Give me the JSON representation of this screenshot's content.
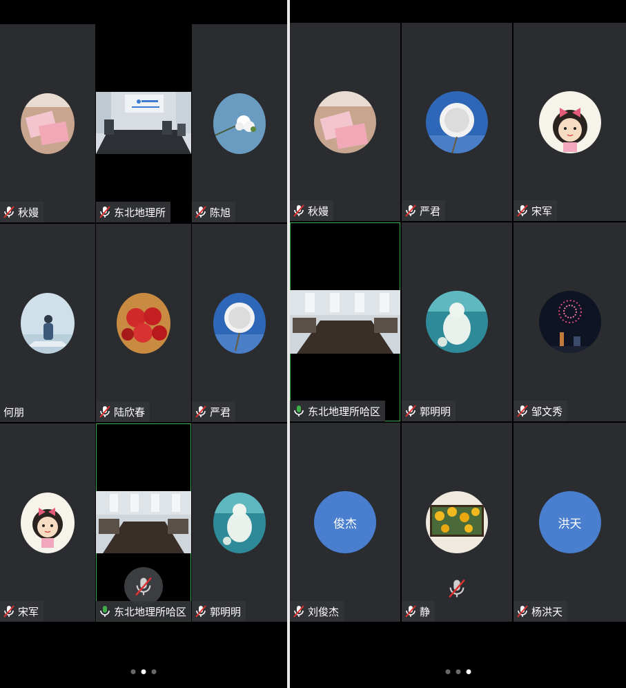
{
  "left_panel": {
    "tiles": [
      {
        "name": "秋嫚",
        "avatar": "red-envelope-photo",
        "mic": "muted"
      },
      {
        "name": "东北地理所",
        "video": "meeting-room-video",
        "mic": "muted"
      },
      {
        "name": "陈旭",
        "avatar": "white-flower-photo",
        "mic": "muted"
      },
      {
        "name": "何朋",
        "avatar": "person-on-boat-photo",
        "mic": "none"
      },
      {
        "name": "陆欣春",
        "avatar": "apples-photo",
        "mic": "muted"
      },
      {
        "name": "严君",
        "avatar": "dandelion-photo",
        "mic": "muted"
      },
      {
        "name": "宋军",
        "avatar": "cartoon-girl-photo",
        "mic": "muted"
      },
      {
        "name": "东北地理所哈区",
        "video": "meeting-room-video",
        "mic": "active"
      },
      {
        "name": "郭明明",
        "avatar": "polar-bear-photo",
        "mic": "muted"
      }
    ],
    "page_dots": 3,
    "active_dot": 1
  },
  "right_panel": {
    "tiles": [
      {
        "name": "秋嫚",
        "avatar": "red-envelope-photo",
        "mic": "muted"
      },
      {
        "name": "严君",
        "avatar": "dandelion-photo",
        "mic": "muted"
      },
      {
        "name": "宋军",
        "avatar": "cartoon-girl-photo",
        "mic": "muted"
      },
      {
        "name": "东北地理所哈区",
        "video": "meeting-room-video",
        "mic": "active"
      },
      {
        "name": "郭明明",
        "avatar": "polar-bear-photo",
        "mic": "muted"
      },
      {
        "name": "邹文秀",
        "avatar": "fireworks-photo",
        "mic": "muted"
      },
      {
        "name": "刘俊杰",
        "avatar_text": "俊杰",
        "mic": "muted"
      },
      {
        "name": "静",
        "avatar": "sunflowers-photo",
        "mic": "muted"
      },
      {
        "name": "杨洪天",
        "avatar_text": "洪天",
        "mic": "muted"
      }
    ],
    "page_dots": 3,
    "active_dot": 2
  },
  "colors": {
    "tile_bg": "#2a2c2f",
    "active_border": "#3fae4a",
    "mic_active": "#3fae4a",
    "mic_muted_slash": "#e03030",
    "text_avatar_bg": "#4a7fd0"
  }
}
